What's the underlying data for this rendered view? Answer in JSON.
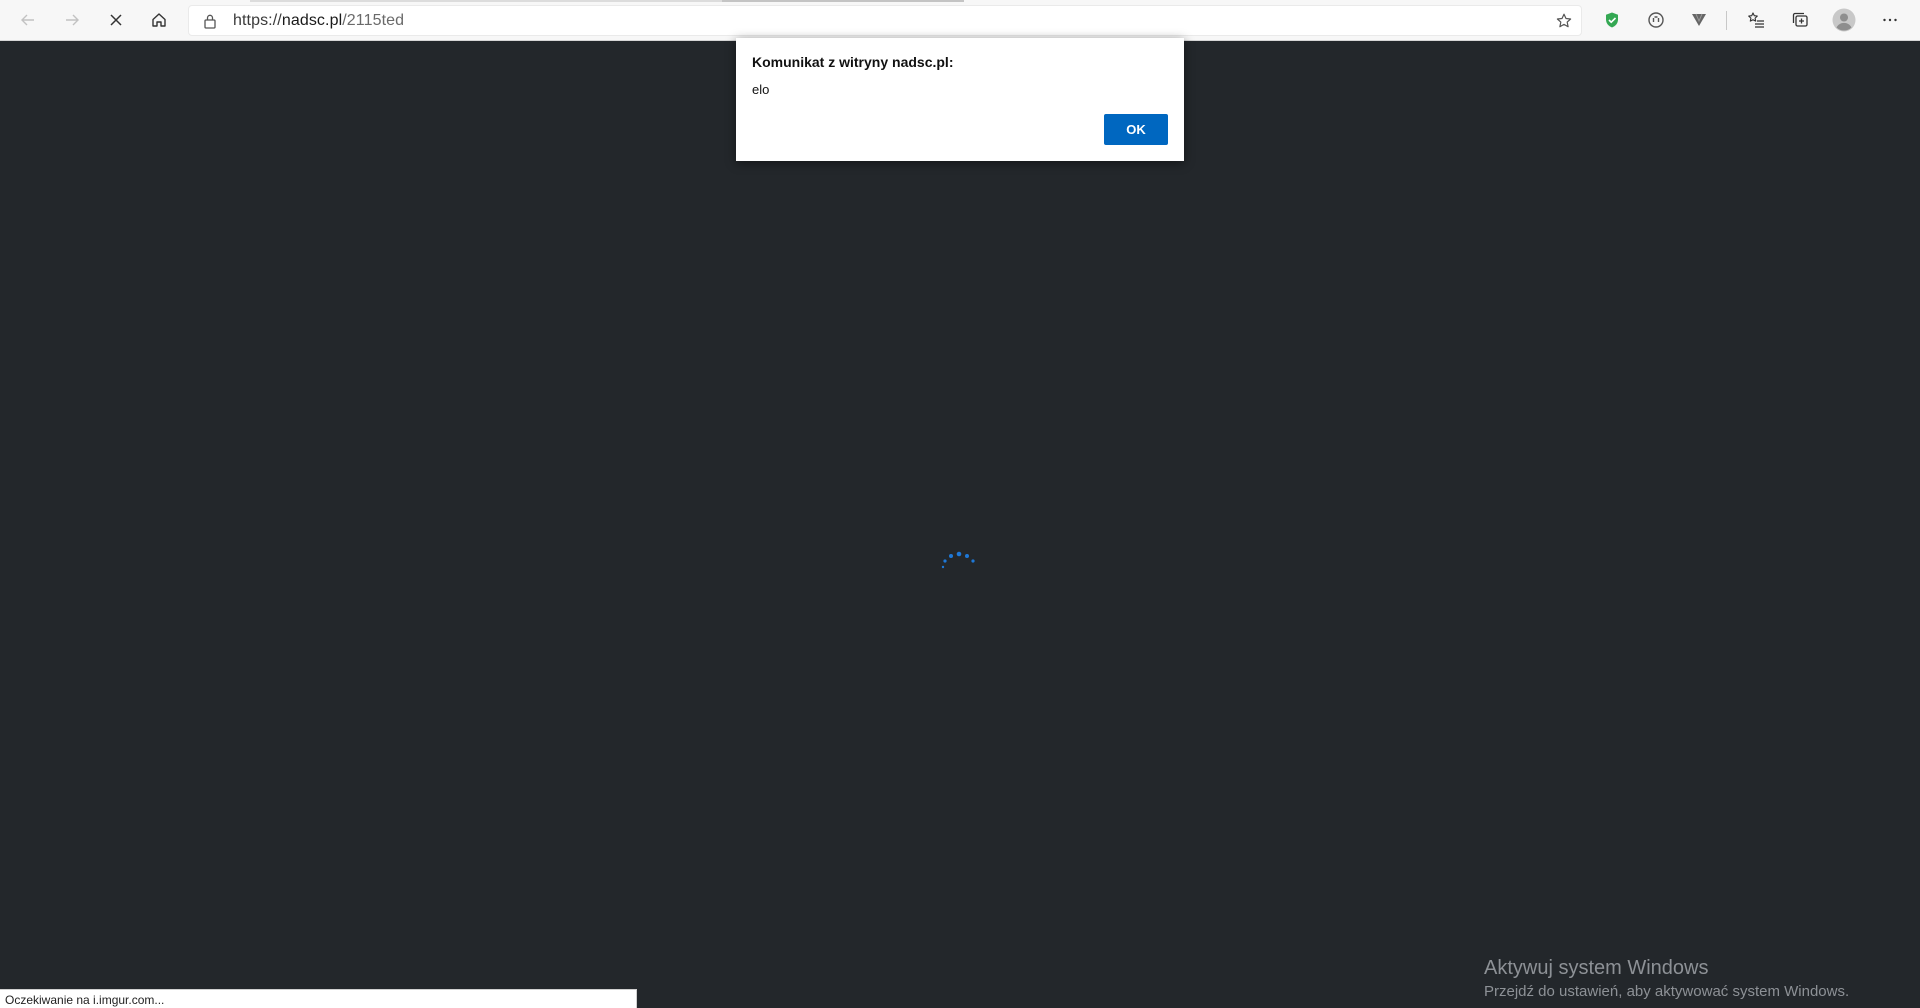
{
  "browser": {
    "url_scheme": "https://",
    "url_host": "nadsc.pl",
    "url_path": "/2115ted",
    "icons": {
      "back": "back-arrow-icon",
      "forward": "forward-arrow-icon",
      "stop": "stop-loading-icon",
      "home": "home-icon",
      "lock": "lock-icon",
      "favorite": "star-icon",
      "extension1": "shield-check-icon",
      "extension2": "privacy-badger-icon",
      "extension3": "v-shape-extension-icon",
      "favorites_bar": "favorites-list-icon",
      "collections": "collections-icon",
      "profile": "profile-avatar-icon",
      "more": "more-ellipsis-icon"
    },
    "accent_color": "#0067c0",
    "shield_color": "#34a853"
  },
  "dialog": {
    "title": "Komunikat z witryny nadsc.pl:",
    "message": "elo",
    "ok_label": "OK"
  },
  "page": {
    "background_color": "#23272b",
    "spinner_color": "#1e78d7"
  },
  "watermark": {
    "title": "Aktywuj system Windows",
    "subtitle": "Przejdź do ustawień, aby aktywować system Windows."
  },
  "status_bar": {
    "text": "Oczekiwanie na i.imgur.com..."
  }
}
